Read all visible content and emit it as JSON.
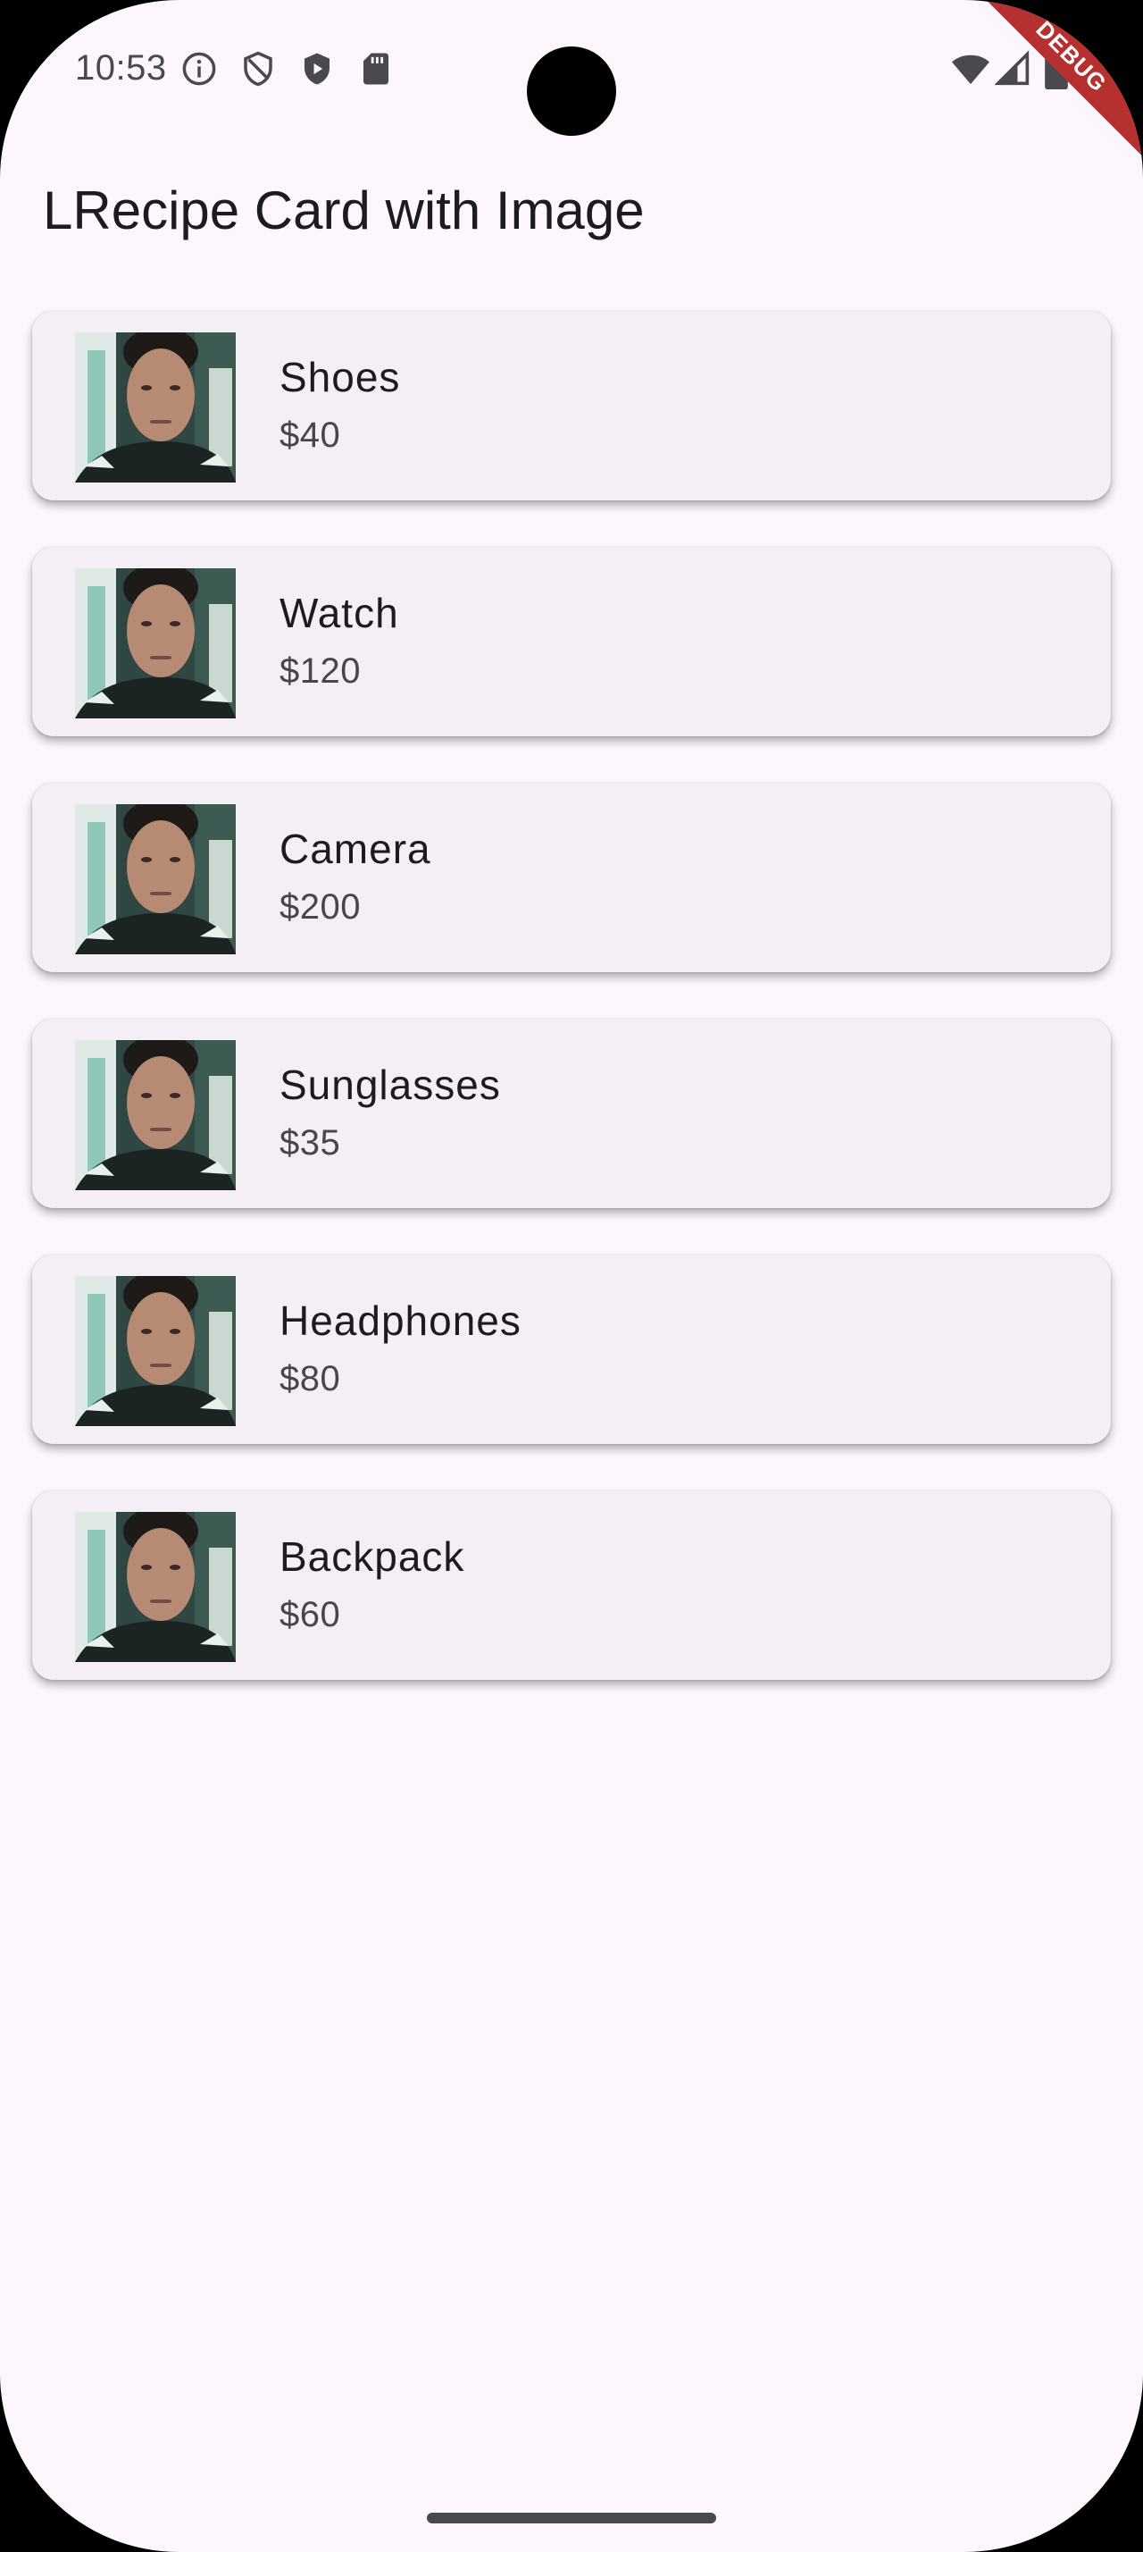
{
  "status_bar": {
    "time": "10:53",
    "left_icons": [
      "info-icon",
      "shield-outline-icon",
      "shield-play-icon",
      "sd-card-icon"
    ],
    "right_icons": [
      "wifi-icon",
      "signal-icon",
      "battery-icon"
    ]
  },
  "debug_banner": "DEBUG",
  "app_bar": {
    "title": "LRecipe Card with Image"
  },
  "items": [
    {
      "name": "Shoes",
      "price": "$40"
    },
    {
      "name": "Watch",
      "price": "$120"
    },
    {
      "name": "Camera",
      "price": "$200"
    },
    {
      "name": "Sunglasses",
      "price": "$35"
    },
    {
      "name": "Headphones",
      "price": "$80"
    },
    {
      "name": "Backpack",
      "price": "$60"
    }
  ],
  "colors": {
    "background": "#fdf7fd",
    "card": "#f4eff5",
    "title_text": "#1d1b20",
    "secondary_text": "#49454f",
    "debug_banner": "#b5302f"
  }
}
